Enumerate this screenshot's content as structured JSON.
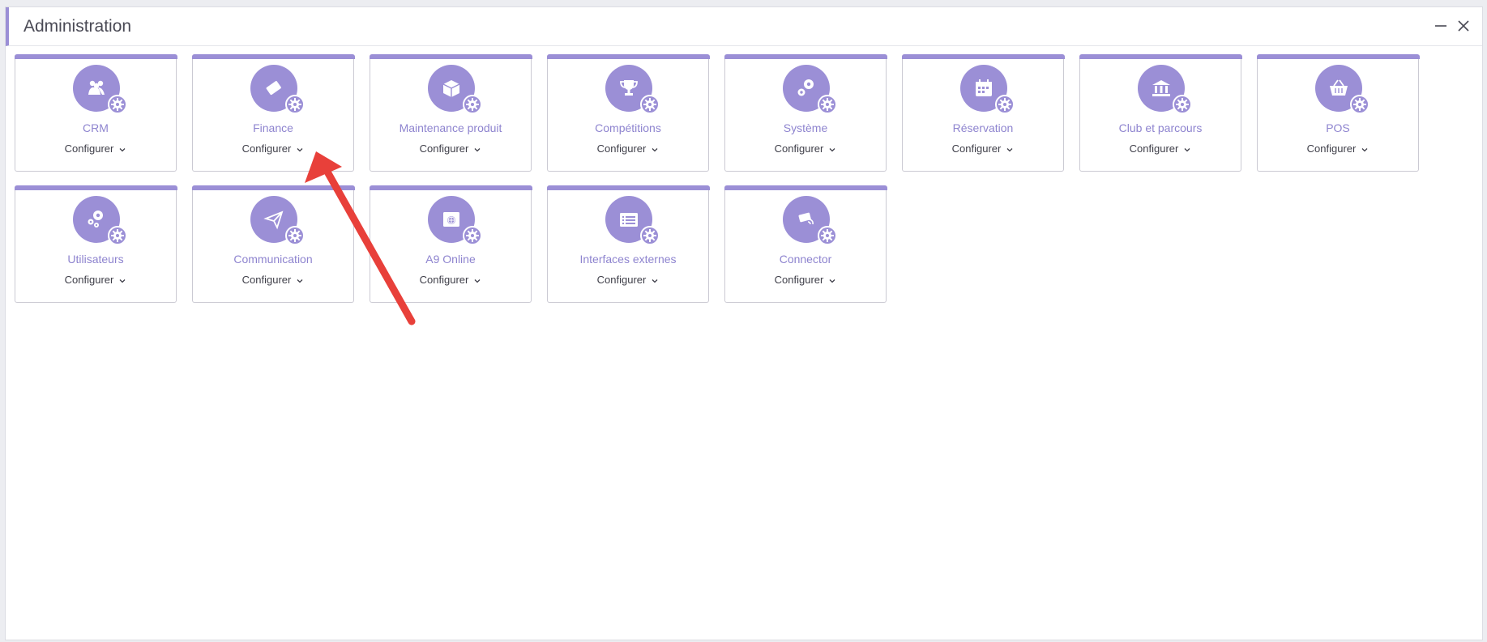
{
  "window": {
    "title": "Administration"
  },
  "modules": [
    {
      "label": "CRM",
      "action": "Configurer",
      "icon": "crm-icon"
    },
    {
      "label": "Finance",
      "action": "Configurer",
      "icon": "finance-icon"
    },
    {
      "label": "Maintenance produit",
      "action": "Configurer",
      "icon": "product-box-icon"
    },
    {
      "label": "Compétitions",
      "action": "Configurer",
      "icon": "trophy-icon"
    },
    {
      "label": "Système",
      "action": "Configurer",
      "icon": "gears-icon"
    },
    {
      "label": "Réservation",
      "action": "Configurer",
      "icon": "calendar-icon"
    },
    {
      "label": "Club et parcours",
      "action": "Configurer",
      "icon": "bank-icon"
    },
    {
      "label": "POS",
      "action": "Configurer",
      "icon": "basket-icon"
    },
    {
      "label": "Utilisateurs",
      "action": "Configurer",
      "icon": "user-gears-icon"
    },
    {
      "label": "Communication",
      "action": "Configurer",
      "icon": "paper-plane-icon"
    },
    {
      "label": "A9 Online",
      "action": "Configurer",
      "icon": "web-icon"
    },
    {
      "label": "Interfaces externes",
      "action": "Configurer",
      "icon": "list-window-icon"
    },
    {
      "label": "Connector",
      "action": "Configurer",
      "icon": "card-connector-icon"
    }
  ],
  "colors": {
    "accent": "#9b8fd6",
    "label": "#8e84cf",
    "annotation_arrow": "#e8403a"
  }
}
